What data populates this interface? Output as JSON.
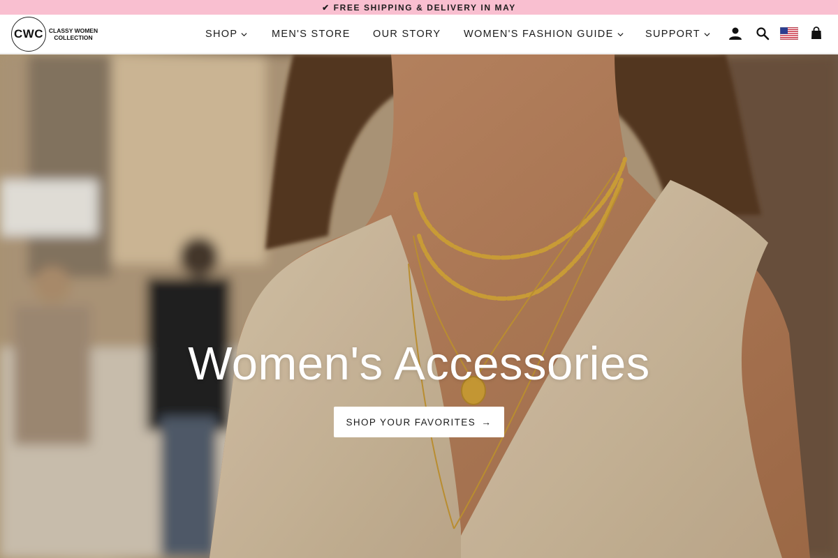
{
  "announcement": {
    "icon": "check-icon",
    "text": "✔ FREE SHIPPING & DELIVERY IN MAY"
  },
  "logo": {
    "monogram": "CWC",
    "line1": "CLASSY WOMEN",
    "line2": "COLLECTION"
  },
  "nav": {
    "shop": "SHOP",
    "mens_store": "MEN'S STORE",
    "our_story": "OUR STORY",
    "fashion_guide": "WOMEN'S FASHION GUIDE",
    "support": "SUPPORT"
  },
  "header_icons": [
    "account-icon",
    "search-icon",
    "us-flag-icon",
    "cart-bag-icon"
  ],
  "hero": {
    "title": "Women's Accessories",
    "button_label": "SHOP YOUR FAVORITES",
    "button_arrow": "→"
  },
  "colors": {
    "announcement_bg": "#f9bfd0",
    "text": "#1a1a1a",
    "button_bg": "#ffffff"
  }
}
